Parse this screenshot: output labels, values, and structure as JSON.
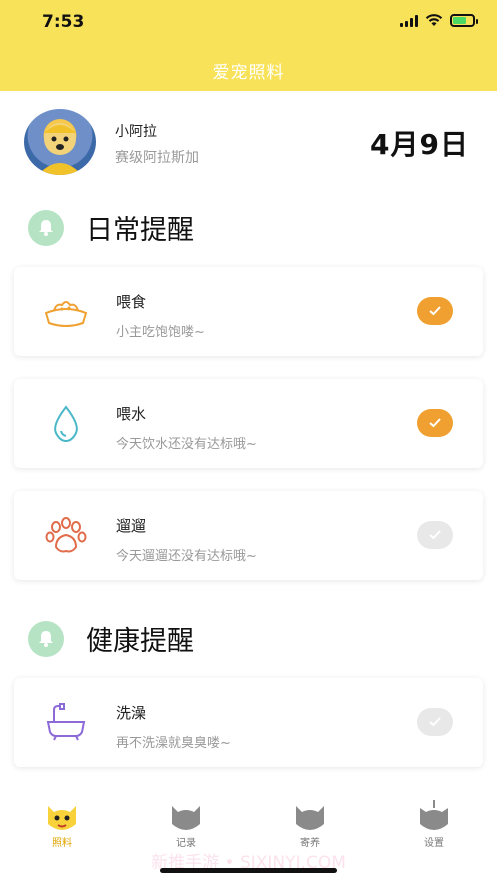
{
  "status_bar": {
    "time": "7:53"
  },
  "header": {
    "title": "爱宠照料"
  },
  "profile": {
    "name": "小阿拉",
    "breed": "赛级阿拉斯加",
    "date": "4月9日"
  },
  "sections": [
    {
      "title": "日常提醒",
      "items": [
        {
          "title": "喂食",
          "subtitle": "小主吃饱饱喽~",
          "done": true,
          "icon": "food-bowl-icon"
        },
        {
          "title": "喂水",
          "subtitle": "今天饮水还没有达标哦~",
          "done": true,
          "icon": "water-drop-icon"
        },
        {
          "title": "遛遛",
          "subtitle": "今天遛遛还没有达标哦~",
          "done": false,
          "icon": "paw-icon"
        }
      ]
    },
    {
      "title": "健康提醒",
      "items": [
        {
          "title": "洗澡",
          "subtitle": "再不洗澡就臭臭喽~",
          "done": false,
          "icon": "bathtub-icon"
        }
      ]
    }
  ],
  "tabbar": {
    "tabs": [
      {
        "label": "照料",
        "active": true
      },
      {
        "label": "记录",
        "active": false
      },
      {
        "label": "寄养",
        "active": false
      },
      {
        "label": "设置",
        "active": false
      }
    ]
  },
  "watermark": "新推手游 • SIXINYI.COM",
  "colors": {
    "header_bg": "#f8e25a",
    "check_done": "#f0a030",
    "check_pending": "#e8e8e8",
    "bell_bg": "#b5e3c3"
  }
}
